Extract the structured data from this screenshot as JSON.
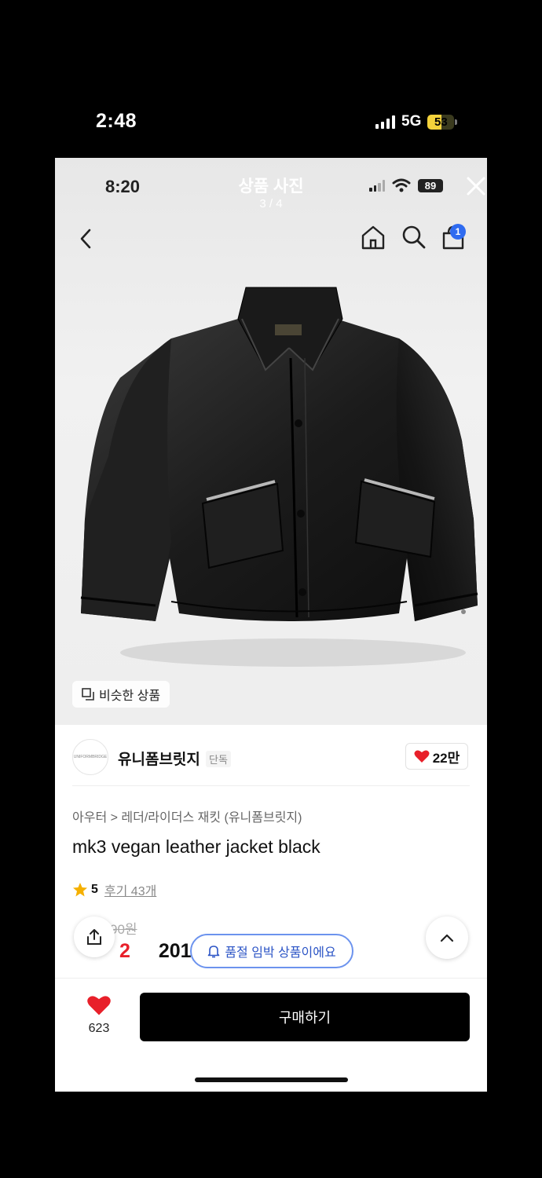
{
  "outer_status": {
    "time": "2:48",
    "network": "5G",
    "battery": "53",
    "battery_level": 0.53
  },
  "inner_status": {
    "time": "8:20",
    "battery": "89"
  },
  "photo_viewer": {
    "title": "상품 사진",
    "counter": "3 / 4",
    "similar_label": "비슷한 상품"
  },
  "nav": {
    "cart_count": "1",
    "icons": [
      "back-arrow-icon",
      "home-icon",
      "search-icon",
      "cart-icon",
      "close-icon"
    ]
  },
  "brand": {
    "name": "유니폼브릿지",
    "tag": "단독",
    "likes": "22만",
    "avatar_text": "UNIFORMBRIDGE"
  },
  "product": {
    "breadcrumb": "아우터 > 레더/라이더스 재킷 (유니폼브릿지)",
    "name": "mk3 vegan leather jacket black",
    "rating": "5",
    "reviews": "후기 43개",
    "original_price": "90원",
    "sale_prefix": "2",
    "price": "201,750",
    "notice": "품절 임박 상품이에요"
  },
  "bottom": {
    "wish_count": "623",
    "buy_label": "구매하기"
  },
  "colors": {
    "accent_blue": "#2f6bf0",
    "heart_red": "#e8202a",
    "star_yellow": "#f5b000",
    "battery_yellow": "#f4d23b"
  }
}
